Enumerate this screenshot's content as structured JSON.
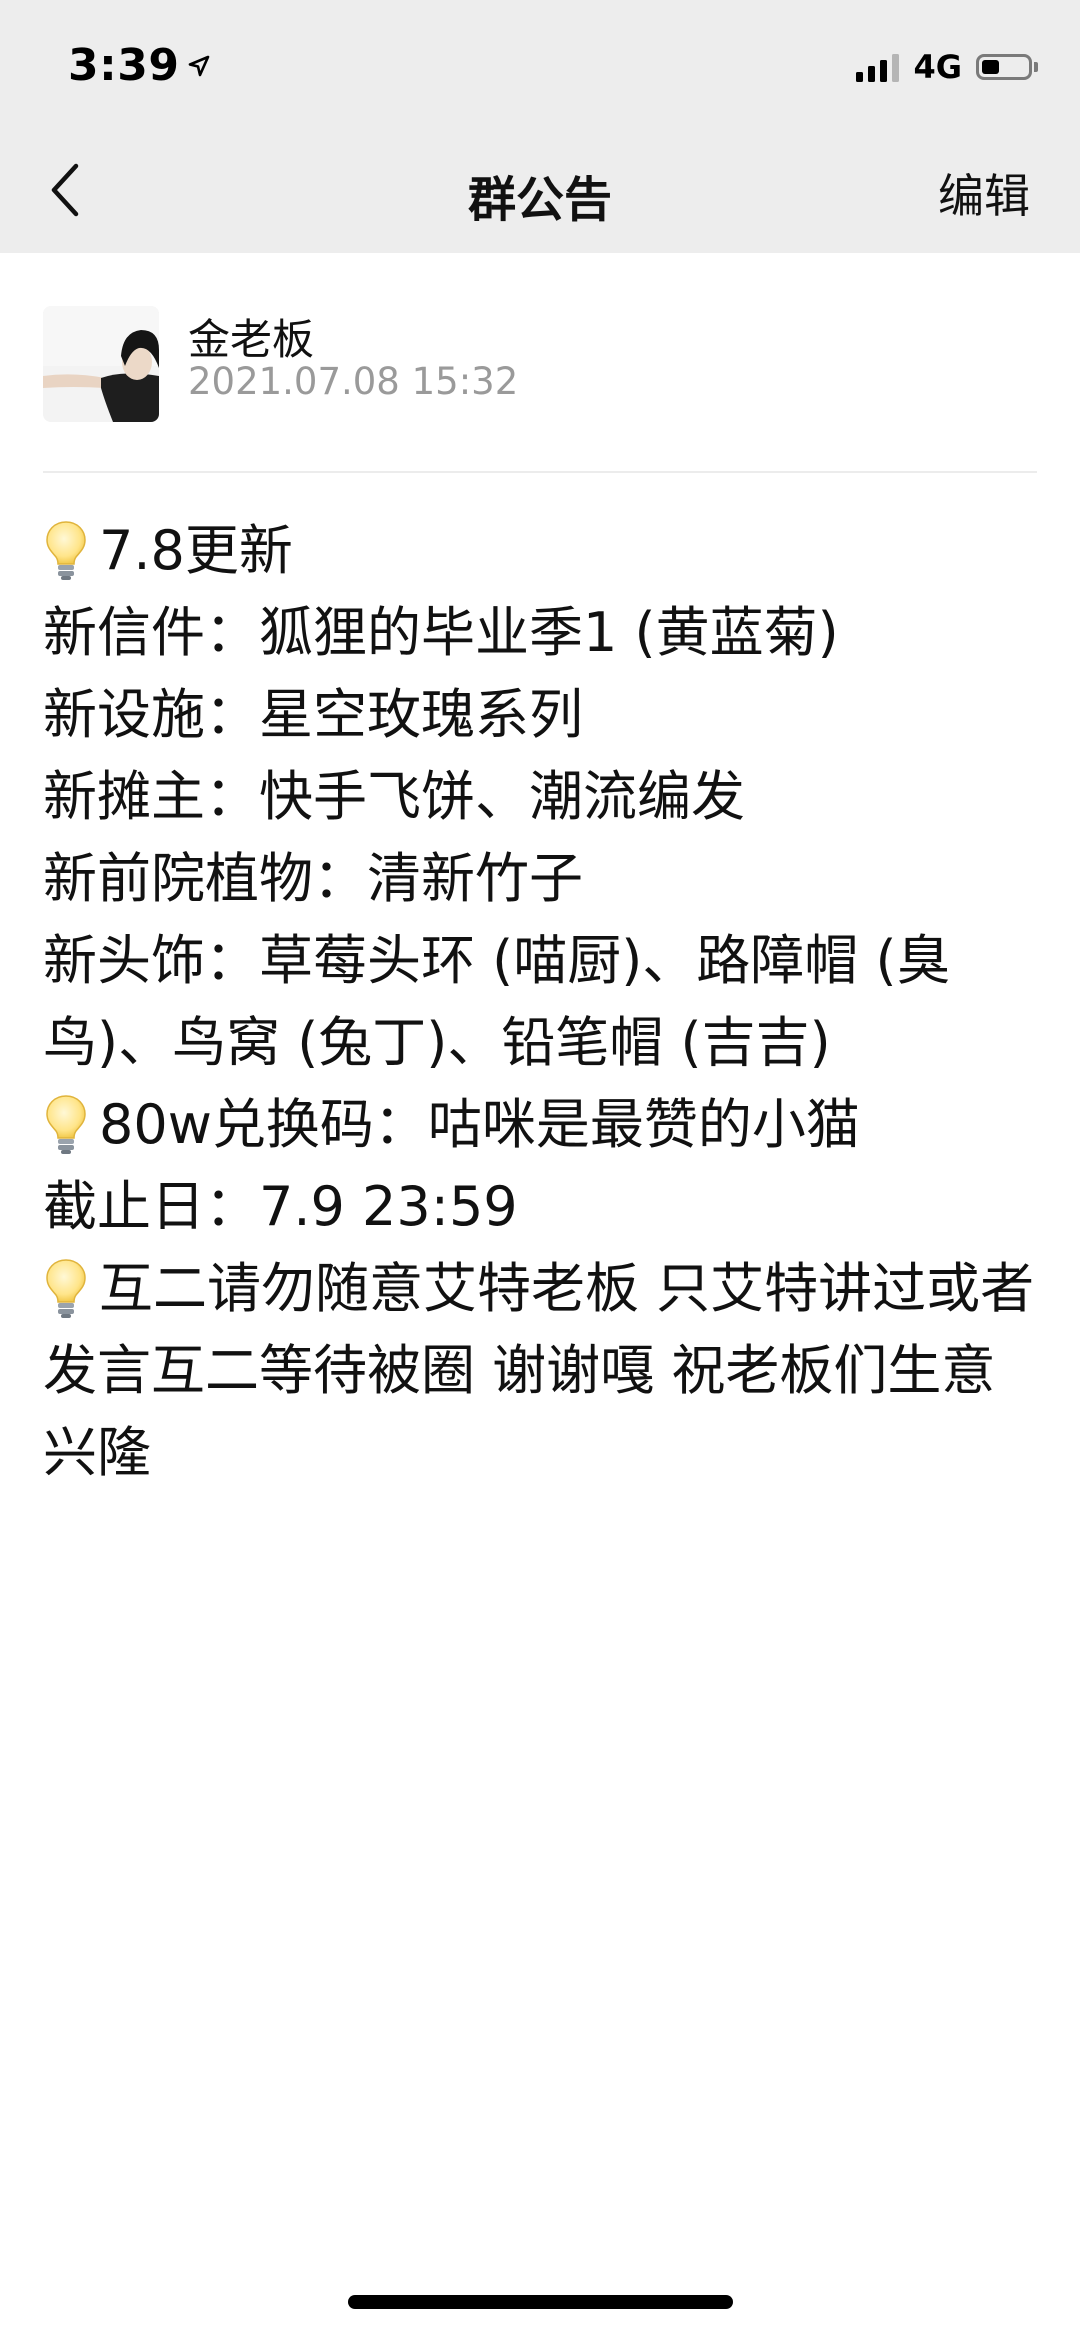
{
  "status_bar": {
    "time": "3:39",
    "network": "4G"
  },
  "nav": {
    "title": "群公告",
    "edit_label": "编辑"
  },
  "author": {
    "name": "金老板",
    "timestamp": "2021.07.08  15:32"
  },
  "announcement": {
    "paragraphs": [
      {
        "bulb": true,
        "text": "7.8更新\n新信件：狐狸的毕业季1 (黄蓝菊)\n新设施：星空玫瑰系列\n新摊主：快手飞饼、潮流编发\n新前院植物：清新竹子\n新头饰：草莓头环 (喵厨)、路障帽 (臭鸟)、鸟窝 (兔丁)、铅笔帽 (吉吉)"
      },
      {
        "bulb": true,
        "text": "80w兑换码：咕咪是最赞的小猫\n截止日：7.9  23:59"
      },
      {
        "bulb": true,
        "text": "互二请勿随意艾特老板 只艾特讲过或者发言互二等待被圈 谢谢嘎 祝老板们生意兴隆"
      }
    ]
  }
}
